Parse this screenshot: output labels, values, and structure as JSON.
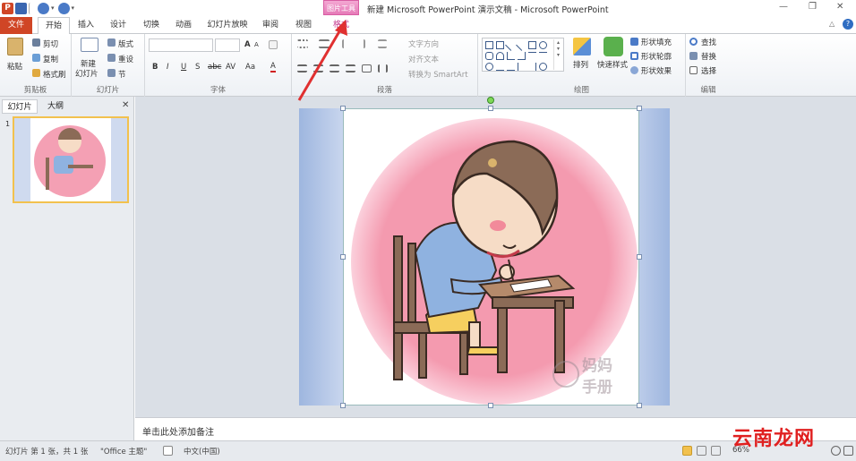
{
  "window": {
    "title": "新建 Microsoft PowerPoint 演示文稿 - Microsoft PowerPoint",
    "context_tab": "图片工具"
  },
  "tabs": [
    {
      "id": "file",
      "label": "文件"
    },
    {
      "id": "home",
      "label": "开始"
    },
    {
      "id": "insert",
      "label": "插入"
    },
    {
      "id": "design",
      "label": "设计"
    },
    {
      "id": "transitions",
      "label": "切换"
    },
    {
      "id": "animations",
      "label": "动画"
    },
    {
      "id": "slideshow",
      "label": "幻灯片放映"
    },
    {
      "id": "review",
      "label": "审阅"
    },
    {
      "id": "view",
      "label": "视图"
    },
    {
      "id": "format",
      "label": "格式"
    }
  ],
  "ribbon": {
    "clipboard": {
      "label": "剪贴板",
      "paste": "粘贴",
      "cut": "剪切",
      "copy": "复制",
      "painter": "格式刷"
    },
    "slides": {
      "label": "幻灯片",
      "new_slide": "新建",
      "new_slide2": "幻灯片",
      "layout": "版式",
      "reset": "重设",
      "section": "节"
    },
    "font": {
      "label": "字体",
      "bold": "B",
      "italic": "I",
      "underline": "U",
      "strike": "S",
      "shadow": "abc",
      "spacing": "AV",
      "aa": "Aa",
      "fontcolor": "A",
      "grow": "A",
      "shrink": "A"
    },
    "paragraph": {
      "label": "段落",
      "text_dir": "文字方向",
      "align_text": "对齐文本",
      "smartart": "转换为 SmartArt"
    },
    "drawing": {
      "label": "绘图",
      "arrange": "排列",
      "quick_styles": "快速样式",
      "fill": "形状填充",
      "outline": "形状轮廓",
      "effects": "形状效果"
    },
    "editing": {
      "label": "编辑",
      "find": "查找",
      "replace": "替换",
      "select": "选择"
    }
  },
  "pane": {
    "tab_slides": "幻灯片",
    "tab_outline": "大纲",
    "slide_number": "1"
  },
  "notes": {
    "placeholder": "单击此处添加备注"
  },
  "status": {
    "slide_info": "幻灯片 第 1 张，共 1 张",
    "theme": "\"Office 主题\"",
    "language": "中文(中国)",
    "zoom": "66%"
  },
  "slide": {
    "watermark_top": "妈妈",
    "watermark_bottom": "手册"
  },
  "site_watermark": "云南龙网",
  "colors": {
    "file_tab": "#d04525",
    "context_tab": "#e67ab8",
    "arrow": "#e03030",
    "pink_circle": "#f4a0b4"
  }
}
